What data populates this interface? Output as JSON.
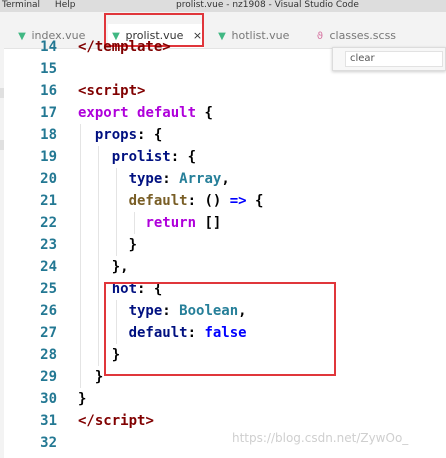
{
  "titlebar": {
    "menu": [
      "Terminal",
      "Help"
    ],
    "window_title": "prolist.vue - nz1908 - Visual Studio Code"
  },
  "tabs": [
    {
      "label": "index.vue",
      "icon": "vue-icon",
      "active": false
    },
    {
      "label": "prolist.vue",
      "icon": "vue-icon",
      "active": true,
      "close": "×"
    },
    {
      "label": "hotlist.vue",
      "icon": "vue-icon",
      "active": false
    },
    {
      "label": "classes.scss",
      "icon": "scss-icon",
      "active": false
    }
  ],
  "find_widget": {
    "value": "clear"
  },
  "code_lines": [
    {
      "number": "14",
      "tokens": [
        [
          "</",
          "t-tag"
        ],
        [
          "template",
          "t-tag"
        ],
        [
          ">",
          "t-tag"
        ]
      ]
    },
    {
      "number": "15",
      "tokens": []
    },
    {
      "number": "16",
      "tokens": [
        [
          "<",
          "t-tag"
        ],
        [
          "script",
          "t-tag"
        ],
        [
          ">",
          "t-tag"
        ]
      ]
    },
    {
      "number": "17",
      "tokens": [
        [
          "export ",
          "t-kw"
        ],
        [
          "default ",
          "t-kw"
        ],
        [
          "{",
          "t-p"
        ]
      ]
    },
    {
      "number": "18",
      "tokens": [
        [
          "  ",
          "t-p"
        ],
        [
          "props",
          "t-prop"
        ],
        [
          ": {",
          "t-p"
        ]
      ]
    },
    {
      "number": "19",
      "tokens": [
        [
          "    ",
          "t-p"
        ],
        [
          "prolist",
          "t-prop"
        ],
        [
          ": {",
          "t-p"
        ]
      ]
    },
    {
      "number": "20",
      "tokens": [
        [
          "      ",
          "t-p"
        ],
        [
          "type",
          "t-prop"
        ],
        [
          ": ",
          "t-p"
        ],
        [
          "Array",
          "t-type"
        ],
        [
          ",",
          "t-p"
        ]
      ]
    },
    {
      "number": "21",
      "tokens": [
        [
          "      ",
          "t-p"
        ],
        [
          "default",
          "t-def"
        ],
        [
          ": () ",
          "t-p"
        ],
        [
          "=>",
          "t-kw2"
        ],
        [
          " {",
          "t-p"
        ]
      ]
    },
    {
      "number": "22",
      "tokens": [
        [
          "        ",
          "t-p"
        ],
        [
          "return",
          "t-kw"
        ],
        [
          " []",
          "t-p"
        ]
      ]
    },
    {
      "number": "23",
      "tokens": [
        [
          "      }",
          "t-p"
        ]
      ]
    },
    {
      "number": "24",
      "tokens": [
        [
          "    },",
          "t-p"
        ]
      ]
    },
    {
      "number": "25",
      "tokens": [
        [
          "    ",
          "t-p"
        ],
        [
          "hot",
          "t-prop"
        ],
        [
          ": {",
          "t-p"
        ]
      ]
    },
    {
      "number": "26",
      "tokens": [
        [
          "      ",
          "t-p"
        ],
        [
          "type",
          "t-prop"
        ],
        [
          ": ",
          "t-p"
        ],
        [
          "Boolean",
          "t-type"
        ],
        [
          ",",
          "t-p"
        ]
      ]
    },
    {
      "number": "27",
      "tokens": [
        [
          "      ",
          "t-p"
        ],
        [
          "default",
          "t-prop"
        ],
        [
          ": ",
          "t-p"
        ],
        [
          "false",
          "t-kw2"
        ]
      ]
    },
    {
      "number": "28",
      "tokens": [
        [
          "    }",
          "t-p"
        ]
      ]
    },
    {
      "number": "29",
      "tokens": [
        [
          "  }",
          "t-p"
        ]
      ]
    },
    {
      "number": "30",
      "tokens": [
        [
          "}",
          "t-p"
        ]
      ]
    },
    {
      "number": "31",
      "tokens": [
        [
          "</",
          "t-tag"
        ],
        [
          "script",
          "t-tag"
        ],
        [
          ">",
          "t-tag"
        ]
      ]
    },
    {
      "number": "32",
      "tokens": []
    }
  ],
  "watermark": "https://blog.csdn.net/ZywOo_",
  "colors": {
    "highlight_box": "#e0363b",
    "line_number": "#237893",
    "vue_icon": "#41b883"
  }
}
